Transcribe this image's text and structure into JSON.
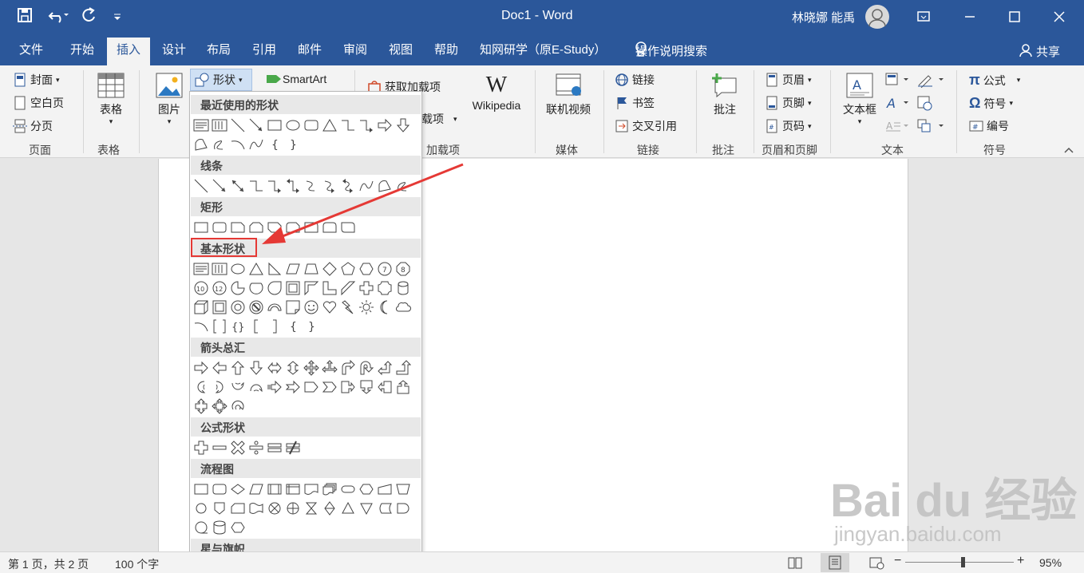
{
  "window": {
    "title": "Doc1  -  Word",
    "user": "林晓娜 能禹"
  },
  "tabs": [
    "文件",
    "开始",
    "插入",
    "设计",
    "布局",
    "引用",
    "邮件",
    "审阅",
    "视图",
    "帮助",
    "知网研学（原E-Study）"
  ],
  "active_tab": "插入",
  "tell_me": "操作说明搜索",
  "share": "共享",
  "ribbon": {
    "pages": {
      "cover": "封面",
      "blank": "空白页",
      "break": "分页",
      "label": "页面"
    },
    "tables": {
      "table": "表格",
      "label": "表格"
    },
    "illustrations": {
      "picture": "图片",
      "shapes": "形状",
      "smartart": "SmartArt"
    },
    "addins": {
      "get": "获取加载项",
      "my": "载项",
      "wikipedia": "Wikipedia",
      "label": "加载项"
    },
    "media": {
      "video": "联机视频",
      "label": "媒体"
    },
    "links": {
      "link": "链接",
      "bookmark": "书签",
      "xref": "交叉引用",
      "label": "链接"
    },
    "comments": {
      "comment": "批注",
      "label": "批注"
    },
    "header_footer": {
      "header": "页眉",
      "footer": "页脚",
      "page_num": "页码",
      "label": "页眉和页脚"
    },
    "text": {
      "textbox": "文本框",
      "label": "文本"
    },
    "symbols": {
      "equation": "公式",
      "symbol": "符号",
      "number": "编号",
      "label": "符号"
    }
  },
  "shapes_dropdown": {
    "sections": [
      "最近使用的形状",
      "线条",
      "矩形",
      "基本形状",
      "箭头总汇",
      "公式形状",
      "流程图",
      "星与旗帜"
    ]
  },
  "status": {
    "page": "第 1 页，共 2 页",
    "words": "100 个字",
    "zoom": "95%"
  },
  "watermark": {
    "brand": "Bai du 经验",
    "url": "jingyan.baidu.com"
  }
}
